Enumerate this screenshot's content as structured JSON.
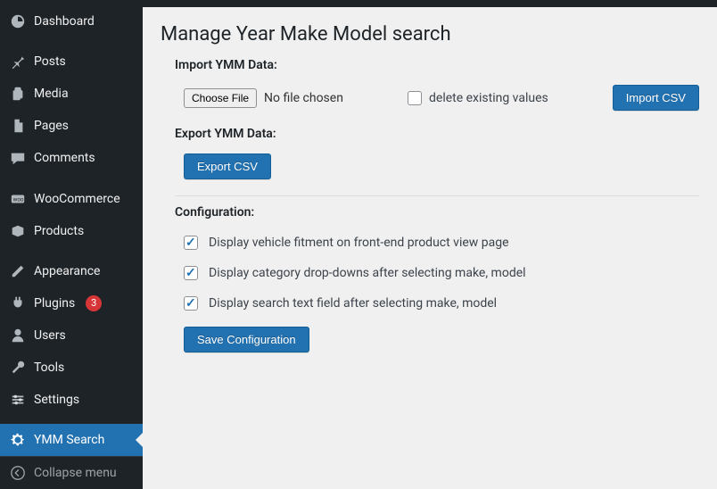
{
  "sidebar": {
    "items": [
      {
        "label": "Dashboard"
      },
      {
        "label": "Posts"
      },
      {
        "label": "Media"
      },
      {
        "label": "Pages"
      },
      {
        "label": "Comments"
      },
      {
        "label": "WooCommerce"
      },
      {
        "label": "Products"
      },
      {
        "label": "Appearance"
      },
      {
        "label": "Plugins",
        "badge": "3"
      },
      {
        "label": "Users"
      },
      {
        "label": "Tools"
      },
      {
        "label": "Settings"
      },
      {
        "label": "YMM Search"
      }
    ],
    "collapse_label": "Collapse menu"
  },
  "page": {
    "title": "Manage Year Make Model search"
  },
  "import": {
    "section_label": "Import YMM Data:",
    "choose_file_label": "Choose File",
    "no_file_text": "No file chosen",
    "delete_existing_label": "delete existing values",
    "delete_existing_checked": false,
    "import_button_label": "Import CSV"
  },
  "export": {
    "section_label": "Export YMM Data:",
    "export_button_label": "Export CSV"
  },
  "config": {
    "section_label": "Configuration:",
    "items": [
      {
        "label": "Display vehicle fitment on front-end product view page",
        "checked": true
      },
      {
        "label": "Display category drop-downs after selecting make, model",
        "checked": true
      },
      {
        "label": "Display search text field after selecting make, model",
        "checked": true
      }
    ],
    "save_button_label": "Save Configuration"
  }
}
